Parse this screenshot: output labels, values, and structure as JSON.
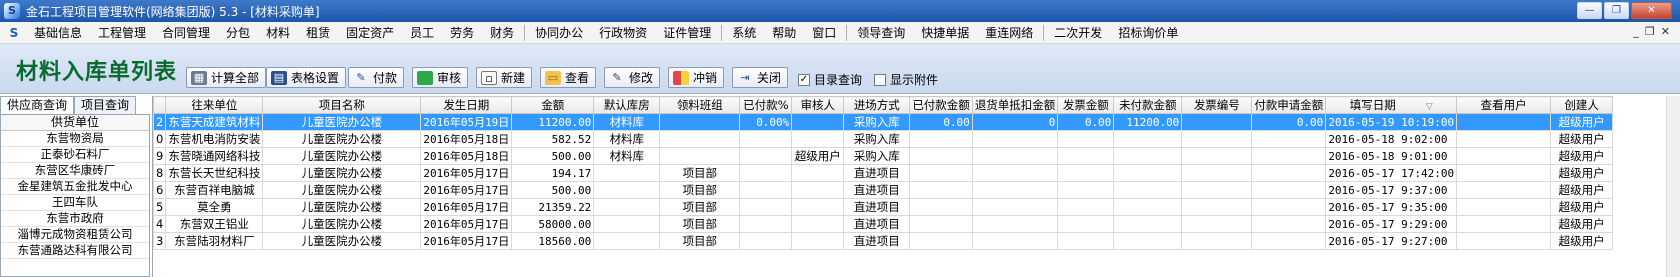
{
  "window": {
    "title": "金石工程项目管理软件(网络集团版) 5.3 - [材料采购单]",
    "controls": [
      "—",
      "❐",
      "✕"
    ]
  },
  "menu": {
    "items": [
      "基础信息",
      "工程管理",
      "合同管理",
      "分包",
      "材料",
      "租赁",
      "固定资产",
      "员工",
      "劳务",
      "财务",
      "协同办公",
      "行政物资",
      "证件管理",
      "系统",
      "帮助",
      "窗口",
      "领导查询",
      "快捷单据",
      "重连网络",
      "二次开发",
      "招标询价单"
    ],
    "mdi_controls": [
      "_",
      "❐",
      "✕"
    ]
  },
  "toolbar": {
    "heading": "材料入库单列表",
    "buttons": [
      "计算全部",
      "表格设置",
      "付款",
      "审核",
      "新建",
      "查看",
      "修改",
      "冲销",
      "关闭"
    ],
    "checkboxes": [
      {
        "label": "目录查询",
        "checked": true
      },
      {
        "label": "显示附件",
        "checked": false
      }
    ]
  },
  "left_panel": {
    "tabs": [
      "供应商查询",
      "项目查询"
    ],
    "list_header": "供货单位",
    "suppliers": [
      "东营物资局",
      "正泰砂石料厂",
      "东营区华康砖厂",
      "金星建筑五金批发中心",
      "王四车队",
      "东营市政府",
      "淄博元成物资租赁公司",
      "东营通路达科有限公司"
    ]
  },
  "grid": {
    "columns": [
      "往来单位",
      "项目名称",
      "发生日期",
      "金额",
      "默认库房",
      "领料班组",
      "已付款%",
      "审核人",
      "进场方式",
      "已付款金额",
      "退货单抵扣金额",
      "发票金额",
      "未付款金额",
      "发票编号",
      "付款申请金额",
      "填写日期",
      "查看用户",
      "创建人"
    ],
    "sort_indicator": "▽",
    "rows": [
      {
        "no": "2",
        "unit": "东营天成建筑材料",
        "project": "儿童医院办公楼",
        "date": "2016年05月19日",
        "amount": "11200.00",
        "warehouse": "材料库",
        "team": "",
        "paid_pct": "0.00%",
        "auditor": "",
        "entry": "采购入库",
        "paid_amt": "0.00",
        "return_amt": "0",
        "invoice_amt": "0.00",
        "unpaid_amt": "11200.00",
        "invoice_no": "",
        "apply_amt": "0.00",
        "fill_date": "2016-05-19 10:19:00",
        "viewer": "",
        "creator": "超级用户"
      },
      {
        "no": "0",
        "unit": "东营机电消防安装",
        "project": "儿童医院办公楼",
        "date": "2016年05月18日",
        "amount": "582.52",
        "warehouse": "材料库",
        "team": "",
        "paid_pct": "",
        "auditor": "",
        "entry": "采购入库",
        "paid_amt": "",
        "return_amt": "",
        "invoice_amt": "",
        "unpaid_amt": "",
        "invoice_no": "",
        "apply_amt": "",
        "fill_date": "2016-05-18 9:02:00",
        "viewer": "",
        "creator": "超级用户"
      },
      {
        "no": "9",
        "unit": "东营晓通网络科技",
        "project": "儿童医院办公楼",
        "date": "2016年05月18日",
        "amount": "500.00",
        "warehouse": "材料库",
        "team": "",
        "paid_pct": "",
        "auditor": "超级用户",
        "entry": "采购入库",
        "paid_amt": "",
        "return_amt": "",
        "invoice_amt": "",
        "unpaid_amt": "",
        "invoice_no": "",
        "apply_amt": "",
        "fill_date": "2016-05-18 9:01:00",
        "viewer": "",
        "creator": "超级用户"
      },
      {
        "no": "8",
        "unit": "东营长天世纪科技",
        "project": "儿童医院办公楼",
        "date": "2016年05月17日",
        "amount": "194.17",
        "warehouse": "",
        "team": "项目部",
        "paid_pct": "",
        "auditor": "",
        "entry": "直进项目",
        "paid_amt": "",
        "return_amt": "",
        "invoice_amt": "",
        "unpaid_amt": "",
        "invoice_no": "",
        "apply_amt": "",
        "fill_date": "2016-05-17 17:42:00",
        "viewer": "",
        "creator": "超级用户"
      },
      {
        "no": "6",
        "unit": "东营百祥电脑城",
        "project": "儿童医院办公楼",
        "date": "2016年05月17日",
        "amount": "500.00",
        "warehouse": "",
        "team": "项目部",
        "paid_pct": "",
        "auditor": "",
        "entry": "直进项目",
        "paid_amt": "",
        "return_amt": "",
        "invoice_amt": "",
        "unpaid_amt": "",
        "invoice_no": "",
        "apply_amt": "",
        "fill_date": "2016-05-17 9:37:00",
        "viewer": "",
        "creator": "超级用户"
      },
      {
        "no": "5",
        "unit": "莫全勇",
        "project": "儿童医院办公楼",
        "date": "2016年05月17日",
        "amount": "21359.22",
        "warehouse": "",
        "team": "项目部",
        "paid_pct": "",
        "auditor": "",
        "entry": "直进项目",
        "paid_amt": "",
        "return_amt": "",
        "invoice_amt": "",
        "unpaid_amt": "",
        "invoice_no": "",
        "apply_amt": "",
        "fill_date": "2016-05-17 9:35:00",
        "viewer": "",
        "creator": "超级用户"
      },
      {
        "no": "4",
        "unit": "东营双王铝业",
        "project": "儿童医院办公楼",
        "date": "2016年05月17日",
        "amount": "58000.00",
        "warehouse": "",
        "team": "项目部",
        "paid_pct": "",
        "auditor": "",
        "entry": "直进项目",
        "paid_amt": "",
        "return_amt": "",
        "invoice_amt": "",
        "unpaid_amt": "",
        "invoice_no": "",
        "apply_amt": "",
        "fill_date": "2016-05-17 9:29:00",
        "viewer": "",
        "creator": "超级用户"
      },
      {
        "no": "3",
        "unit": "东营陆羽材料厂",
        "project": "儿童医院办公楼",
        "date": "2016年05月17日",
        "amount": "18560.00",
        "warehouse": "",
        "team": "项目部",
        "paid_pct": "",
        "auditor": "",
        "entry": "直进项目",
        "paid_amt": "",
        "return_amt": "",
        "invoice_amt": "",
        "unpaid_amt": "",
        "invoice_no": "",
        "apply_amt": "",
        "fill_date": "2016-05-17 9:27:00",
        "viewer": "",
        "creator": "超级用户"
      }
    ]
  },
  "colors": {
    "title_bar": "#1d55a8",
    "heading_green": "#0a6b2f",
    "selection": "#3399ff",
    "toolbar_bg": "#cad9ef"
  }
}
